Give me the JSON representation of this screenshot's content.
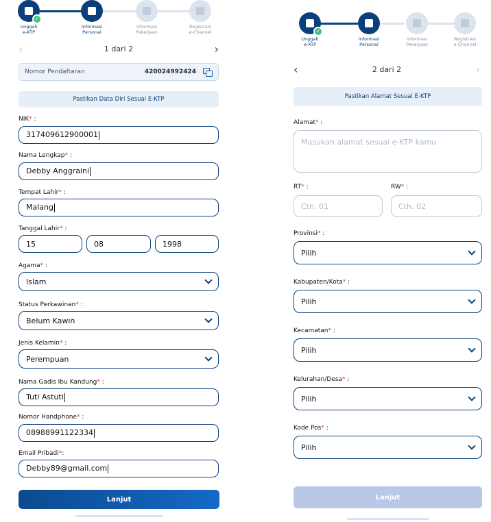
{
  "steps": [
    {
      "label1": "Unggah",
      "label2": "e-KTP"
    },
    {
      "label1": "Informasi",
      "label2": "Personal"
    },
    {
      "label1": "Informasi",
      "label2": "Pekerjaan"
    },
    {
      "label1": "Registrasi",
      "label2": "e-Channel"
    }
  ],
  "left": {
    "pager": "1 dari 2",
    "registration": {
      "label": "Nomor Pendaftaran",
      "value": "420024992424"
    },
    "banner": "Pastikan Data Diri Sesuai E-KTP",
    "nik": {
      "label": "NIK",
      "value": "317409612900001"
    },
    "nama": {
      "label": "Nama Lengkap",
      "value": "Debby Anggraini"
    },
    "tempat": {
      "label": "Tempat Lahir",
      "value": "Malang"
    },
    "tanggal": {
      "label": "Tanggal Lahir",
      "day": "15",
      "month": "08",
      "year": "1998"
    },
    "agama": {
      "label": "Agama",
      "value": "Islam"
    },
    "status": {
      "label": "Status Perkawinan",
      "value": "Belum Kawin"
    },
    "jenis": {
      "label": "Jenis Kelamin",
      "value": "Perempuan"
    },
    "ibu": {
      "label": "Nama Gadis Ibu Kandung",
      "value": "Tuti Astuti"
    },
    "hp": {
      "label": "Nomor Handphone",
      "value": "08988991122334"
    },
    "email": {
      "label": "Email Pribadi",
      "value": "Debby89@gmail.com"
    },
    "button": "Lanjut"
  },
  "right": {
    "pager": "2 dari 2",
    "banner": "Pastikan Alamat Sesuai E-KTP",
    "alamat": {
      "label": "Alamat",
      "placeholder": "Masukan alamat sesuai e-KTP kamu"
    },
    "rt": {
      "label": "RT",
      "placeholder": "Cth. 01"
    },
    "rw": {
      "label": "RW",
      "placeholder": "Cth. 02"
    },
    "provinsi": {
      "label": "Provinsi",
      "value": "Pilih"
    },
    "kabupaten": {
      "label": "Kabupaten/Kota",
      "value": "Pilih"
    },
    "kecamatan": {
      "label": "Kecamatan",
      "value": "Pilih"
    },
    "kelurahan": {
      "label": "Kelurahan/Desa",
      "value": "Pilih"
    },
    "kodepos": {
      "label": "Kode Pos",
      "value": "Pilih"
    },
    "button": "Lanjut"
  },
  "colors": {
    "primary": "#0b3f7a",
    "required": "#e0334e",
    "success": "#3cc27a",
    "disabled": "#b9c8e6"
  }
}
